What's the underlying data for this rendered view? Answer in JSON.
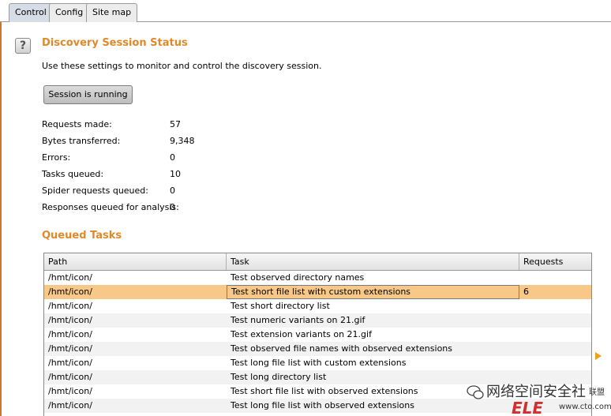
{
  "tabs": [
    {
      "label": "Control",
      "active": true
    },
    {
      "label": "Config",
      "active": false
    },
    {
      "label": "Site map",
      "active": false
    }
  ],
  "status_section": {
    "title": "Discovery Session Status",
    "description": "Use these settings to monitor and control the discovery session.",
    "session_button": "Session is running"
  },
  "stats": [
    {
      "label": "Requests made:",
      "value": "57"
    },
    {
      "label": "Bytes transferred:",
      "value": "9,348"
    },
    {
      "label": "Errors:",
      "value": "0"
    },
    {
      "label": "Tasks queued:",
      "value": "10"
    },
    {
      "label": "Spider requests queued:",
      "value": "0"
    },
    {
      "label": "Responses queued for analysis:",
      "value": "0"
    }
  ],
  "queue_section": {
    "title": "Queued Tasks",
    "columns": [
      "Path",
      "Task",
      "Requests"
    ],
    "rows": [
      {
        "path": "/hmt/icon/",
        "task": "Test observed directory names",
        "requests": ""
      },
      {
        "path": "/hmt/icon/",
        "task": "Test short file list with custom extensions",
        "requests": "6"
      },
      {
        "path": "/hmt/icon/",
        "task": "Test short directory list",
        "requests": ""
      },
      {
        "path": "/hmt/icon/",
        "task": "Test numeric variants on 21.gif",
        "requests": ""
      },
      {
        "path": "/hmt/icon/",
        "task": "Test extension variants on 21.gif",
        "requests": ""
      },
      {
        "path": "/hmt/icon/",
        "task": "Test observed file names with observed extensions",
        "requests": ""
      },
      {
        "path": "/hmt/icon/",
        "task": "Test long file list with custom extensions",
        "requests": ""
      },
      {
        "path": "/hmt/icon/",
        "task": "Test long directory list",
        "requests": ""
      },
      {
        "path": "/hmt/icon/",
        "task": "Test short file list with observed extensions",
        "requests": ""
      },
      {
        "path": "/hmt/icon/",
        "task": "Test long file list with observed extensions",
        "requests": ""
      }
    ],
    "selected_row": 1
  },
  "watermark": {
    "text": "网络空间安全社",
    "text2": "联盟",
    "logo": "ELE",
    "url": "www.cto.com",
    "icon": "wechat-icon"
  },
  "colors": {
    "accent": "#e0892a",
    "selection": "#f8c888",
    "tab_active": "#d7dde6"
  }
}
